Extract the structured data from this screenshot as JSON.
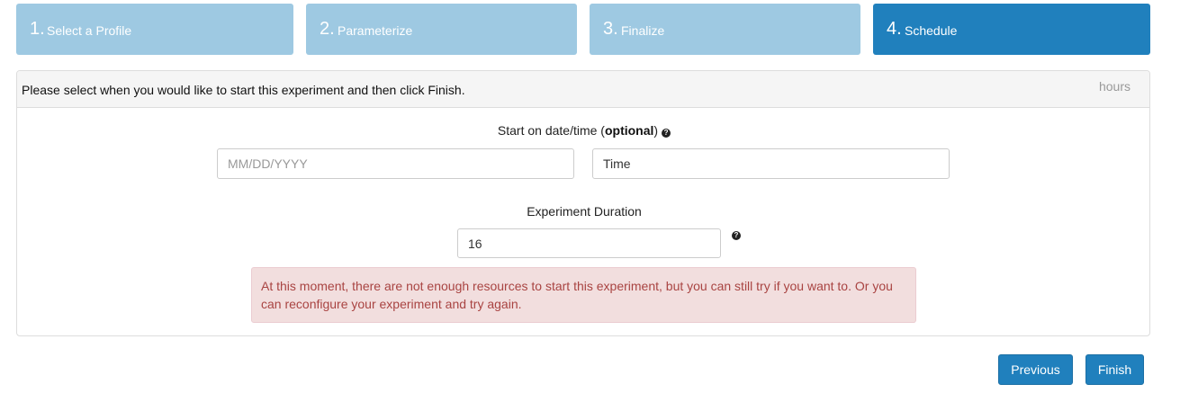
{
  "wizard": {
    "steps": [
      {
        "number": "1.",
        "label": "Select a Profile",
        "active": false
      },
      {
        "number": "2.",
        "label": "Parameterize",
        "active": false
      },
      {
        "number": "3.",
        "label": "Finalize",
        "active": false
      },
      {
        "number": "4.",
        "label": "Schedule",
        "active": true
      }
    ]
  },
  "panel": {
    "instruction": "Please select when you would like to start this experiment and then click Finish.",
    "hours_label": "hours"
  },
  "start": {
    "label_prefix": "Start on date/time (",
    "label_bold": "optional",
    "label_suffix": ")",
    "help_icon": "?",
    "date": {
      "value": "",
      "placeholder": "MM/DD/YYYY"
    },
    "time": {
      "value": "Time",
      "placeholder": "Time"
    }
  },
  "duration": {
    "label": "Experiment Duration",
    "value": "16",
    "help_icon": "?"
  },
  "alert": {
    "message": "At this moment, there are not enough resources to start this experiment, but you can still try if you want to. Or you can reconfigure your experiment and try again."
  },
  "buttons": {
    "previous": "Previous",
    "finish": "Finish"
  },
  "colors": {
    "step_inactive": "#9ec9e2",
    "step_active": "#2080bd",
    "alert_bg": "#f2dede",
    "alert_text": "#a94442",
    "button": "#2080bd"
  }
}
